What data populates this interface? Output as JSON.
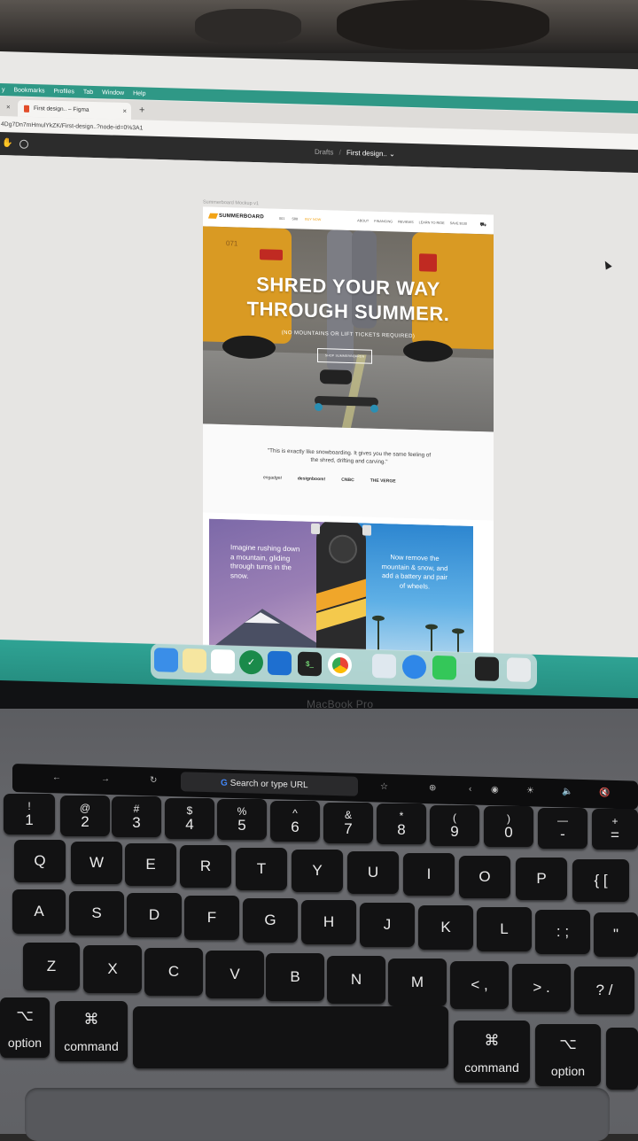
{
  "mac_menu": [
    "y",
    "Bookmarks",
    "Profiles",
    "Tab",
    "Window",
    "Help"
  ],
  "browser": {
    "tab_title": "First design.. – Figma",
    "tab_close": "×",
    "new_tab": "+",
    "url": "4Dg7Dn7mHmulYkZK/First-design..?node-id=0%3A1"
  },
  "figma": {
    "breadcrumb_parent": "Drafts",
    "breadcrumb_sep": "/",
    "breadcrumb_current": "First design.. ⌄",
    "frame_label": "Summerboard Mockup v1"
  },
  "site": {
    "logo": "SUMMERBOARD",
    "nav_left": [
      "001",
      "S88",
      "BUY NOW"
    ],
    "nav_right": [
      "ABOUT",
      "FINANCING",
      "REVIEWS",
      "LEARN TO RIDE",
      "SAVE $100"
    ],
    "hero_title_line1": "SHRED YOUR WAY",
    "hero_title_line2": "THROUGH SUMMER.",
    "hero_subtitle": "(NO MOUNTAINS OR LIFT TICKETS REQUIRED)",
    "hero_button": "SHOP SUMMERBOARDS",
    "taxi_number": "071",
    "quote": "\"This is exactly like snowboarding. It gives you the same feeling of the shred, drifting and carving.\"",
    "press_logos": [
      "engadget",
      "designboom!",
      "CNBC",
      "THE VERGE"
    ],
    "promo_left": "Imagine rushing down a mountain, gliding through turns in the snow.",
    "promo_right": "Now remove the mountain & snow, and add a battery and pair of wheels."
  },
  "laptop_label": "MacBook Pro",
  "touchbar": {
    "search": "Search or type URL",
    "g": "G"
  },
  "keyboard": {
    "num_row": [
      {
        "top": "!",
        "bottom": "1"
      },
      {
        "top": "@",
        "bottom": "2"
      },
      {
        "top": "#",
        "bottom": "3"
      },
      {
        "top": "$",
        "bottom": "4"
      },
      {
        "top": "%",
        "bottom": "5"
      },
      {
        "top": "^",
        "bottom": "6"
      },
      {
        "top": "&",
        "bottom": "7"
      },
      {
        "top": "*",
        "bottom": "8"
      },
      {
        "top": "(",
        "bottom": "9"
      },
      {
        "top": ")",
        "bottom": "0"
      },
      {
        "top": "—",
        "bottom": "-"
      },
      {
        "top": "+",
        "bottom": "="
      }
    ],
    "row_q": [
      "Q",
      "W",
      "E",
      "R",
      "T",
      "Y",
      "U",
      "I",
      "O",
      "P",
      "{ ["
    ],
    "row_a": [
      "A",
      "S",
      "D",
      "F",
      "G",
      "H",
      "J",
      "K",
      "L",
      ": ;",
      "\""
    ],
    "row_z": [
      "Z",
      "X",
      "C",
      "V",
      "B",
      "N",
      "M",
      "< ,",
      "> .",
      "? /"
    ],
    "option_left": "option",
    "option_symbol": "⌥",
    "command_left": "command",
    "command_symbol": "⌘",
    "command_right": "command",
    "option_right": "option"
  }
}
